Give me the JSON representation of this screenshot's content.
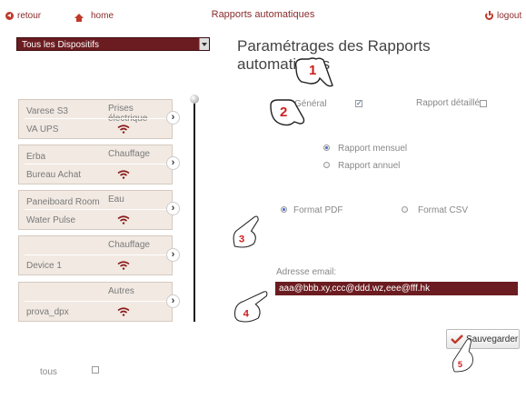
{
  "header": {
    "back_label": "retour",
    "home_label": "home",
    "app_title": "Rapports automatiques",
    "logout_label": "logout"
  },
  "device_select": {
    "value": "Tous les Dispositifs"
  },
  "devices": [
    {
      "name": "Varese S3",
      "type": "Prises électrique",
      "sub": "VA UPS"
    },
    {
      "name": "Erba",
      "type": "Chauffage",
      "sub": "Bureau Achat"
    },
    {
      "name": "Paneiboard Room",
      "type": "Eau",
      "sub": "Water Pulse"
    },
    {
      "name": "",
      "type": "Chauffage",
      "sub": "Device 1"
    },
    {
      "name": "",
      "type": "Autres",
      "sub": "prova_dpx"
    }
  ],
  "select_all_label": "tous",
  "main": {
    "title": "Paramétrages des Rapports automatiques",
    "general_label": "Général",
    "general_checked": true,
    "detailed_label": "Rapport détaillé",
    "detailed_checked": false,
    "monthly_label": "Rapport mensuel",
    "annual_label": "Rapport annuel",
    "selected_period": "monthly",
    "pdf_label": "Format PDF",
    "csv_label": "Format CSV",
    "selected_format": "pdf",
    "email_label": "Adresse email:",
    "email_value": "aaa@bbb.xy,ccc@ddd.wz,eee@fff.hk",
    "save_label": "Sauvegarder"
  },
  "callouts": [
    "1",
    "2",
    "3",
    "4",
    "5"
  ],
  "colors": {
    "accent": "#6b1c20",
    "link": "#8b2b2b",
    "callout": "#cc1e1e"
  }
}
